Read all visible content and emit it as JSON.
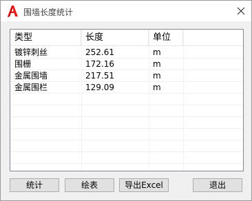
{
  "window": {
    "title": "围墙长度统计"
  },
  "table": {
    "columns": [
      "类型",
      "长度",
      "单位"
    ],
    "rows": [
      {
        "type": "镀锌刺丝",
        "length": "252.61",
        "unit": "m"
      },
      {
        "type": "围栅",
        "length": "172.16",
        "unit": "m"
      },
      {
        "type": "金属围墙",
        "length": "217.51",
        "unit": "m"
      },
      {
        "type": "金属围栏",
        "length": "129.09",
        "unit": "m"
      }
    ]
  },
  "buttons": {
    "stats": "统计",
    "draw_table": "绘表",
    "export_excel": "导出Excel",
    "exit": "退出"
  }
}
